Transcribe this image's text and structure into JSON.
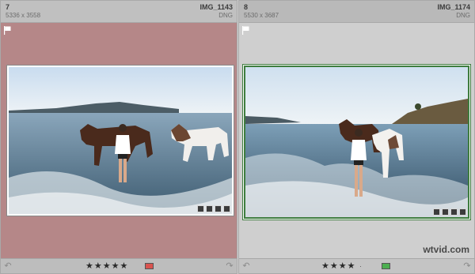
{
  "cells": [
    {
      "index": "7",
      "dimensions": "5336 x 3558",
      "filename": "IMG_1143",
      "filetype": "DNG",
      "rating": "★★★★★",
      "color_label": "#d9534f",
      "background": "#b58788"
    },
    {
      "index": "8",
      "dimensions": "5530 x 3687",
      "filename": "IMG_1174",
      "filetype": "DNG",
      "rating": "★★★★",
      "rating_empty": "·",
      "color_label": "#4caf50",
      "background": "#cfcfcf"
    }
  ],
  "watermark": "wtvid.com"
}
